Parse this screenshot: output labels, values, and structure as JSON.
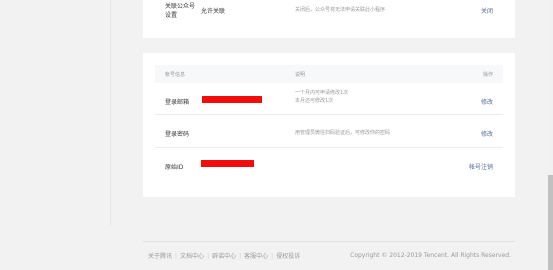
{
  "top_card": {
    "label": "关联公众号设置",
    "value": "允许关联",
    "description": "关闭后，公众号将无法申请关联此小程序",
    "action": "关闭"
  },
  "account_card": {
    "headers": {
      "info": "帐号信息",
      "desc": "说明",
      "op": "操作"
    },
    "rows": [
      {
        "label": "登录邮箱",
        "desc_line1": "一个月内可申请修改1次",
        "desc_line2": "本月还可修改1次",
        "action": "修改"
      },
      {
        "label": "登录密码",
        "desc_line1": "用管理员微信扫码验证后，可修改你的密码",
        "action": "修改"
      },
      {
        "label": "原始ID",
        "action": "帐号注销"
      }
    ]
  },
  "footer": {
    "links": [
      "关于腾讯",
      "文档中心",
      "辟谣中心",
      "客服中心",
      "侵权投诉"
    ],
    "copyright": "Copyright © 2012-2019 Tencent. All Rights Reserved."
  },
  "colors": {
    "redaction": "#f20c0c",
    "link": "#576b95"
  }
}
